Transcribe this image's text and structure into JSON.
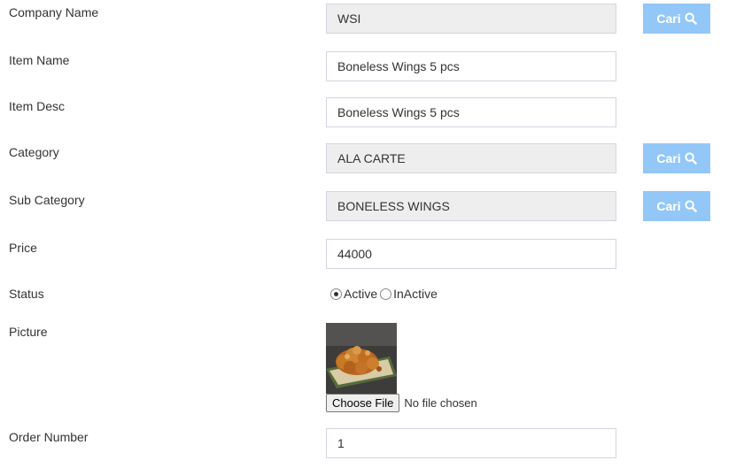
{
  "form": {
    "company": {
      "label": "Company Name",
      "value": "WSI"
    },
    "item_name": {
      "label": "Item Name",
      "value": "Boneless Wings 5 pcs"
    },
    "item_desc": {
      "label": "Item Desc",
      "value": "Boneless Wings 5 pcs"
    },
    "category": {
      "label": "Category",
      "value": "ALA CARTE"
    },
    "sub_category": {
      "label": "Sub Category",
      "value": "BONELESS WINGS"
    },
    "price": {
      "label": "Price",
      "value": "44000"
    },
    "status": {
      "label": "Status",
      "options": [
        "Active",
        "InActive"
      ],
      "selected": "Active"
    },
    "picture": {
      "label": "Picture",
      "choose_label": "Choose File",
      "file_text": "No file chosen"
    },
    "order_number": {
      "label": "Order Number",
      "value": "1"
    }
  },
  "buttons": {
    "cari_label": "Cari"
  },
  "icons": {
    "search": "search-icon",
    "radio": "radio-icon"
  },
  "colors": {
    "button_bg": "#93c7f7",
    "readonly_bg": "#eeeeee",
    "border": "#d2d6de"
  }
}
